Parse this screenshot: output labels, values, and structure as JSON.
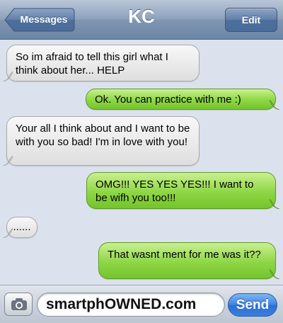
{
  "navbar": {
    "back_label": "Messages",
    "title": "KC",
    "edit_label": "Edit"
  },
  "messages": [
    {
      "direction": "incoming",
      "text": "So im afraid to tell this girl what I think about her... HELP"
    },
    {
      "direction": "outgoing",
      "text": "Ok. You can practice with me :)"
    },
    {
      "direction": "incoming",
      "text": "Your all I think about and I want to be with you so bad! I'm in love with you!"
    },
    {
      "direction": "outgoing",
      "text": "OMG!!! YES YES YES!!! I want to be wifh you too!!!"
    },
    {
      "direction": "incoming",
      "text": "......"
    },
    {
      "direction": "outgoing",
      "text": "That wasnt ment for me was it??"
    }
  ],
  "input_bar": {
    "camera_icon": "camera-icon",
    "field_value": "smartphOWNED.com",
    "send_label": "Send"
  },
  "colors": {
    "incoming_bubble": "#e9e9e9",
    "outgoing_bubble": "#8ed646",
    "background": "#dbe2ed",
    "send_button": "#3b7fe0"
  }
}
